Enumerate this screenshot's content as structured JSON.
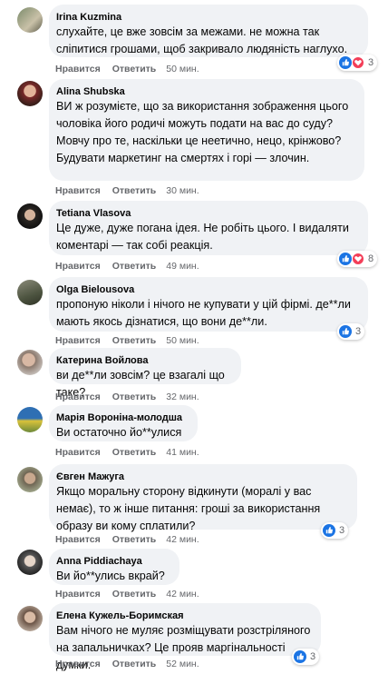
{
  "actions": {
    "like": "Нравится",
    "reply": "Ответить"
  },
  "comments": [
    {
      "author": "Irina Kuzmina",
      "text": "слухайте, це вже зовсім за межами. не можна так сліпитися грошами, щоб закривало людяність наглухо.",
      "time": "50 мин.",
      "reactions": "3",
      "icon": "avatar-photo"
    },
    {
      "author": "Alina Shubska",
      "text": "ВИ ж розумієте, що за використання зображення цього чоловіка його родичі можуть подати на вас до суду? Мовчу про те, наскільки це неетично, нецо, крінжово? Будувати маркетинг на смертях і горі — злочин.",
      "time": "30 мин.",
      "reactions": "",
      "icon": "avatar-photo"
    },
    {
      "author": "Tetiana Vlasova",
      "text": "Це дуже, дуже погана ідея. Не робіть цього. І видаляти коментарі — так собі реакція.",
      "time": "49 мин.",
      "reactions": "8",
      "icon": "avatar-photo"
    },
    {
      "author": "Olga Bielousova",
      "text": "пропоную ніколи і нічого не купувати у цій фірмі. де**ли мають якось дізнатися, що вони де**ли.",
      "time": "50 мин.",
      "reactions": "3",
      "icon": "avatar-photo"
    },
    {
      "author": "Катерина Войлова",
      "text": "ви де**ли зовсім? це взагалі що таке?",
      "time": "32 мин.",
      "reactions": "",
      "icon": "avatar-photo"
    },
    {
      "author": "Марія Вороніна-молодша",
      "text": "Ви остаточно йо**улися",
      "time": "41 мин.",
      "reactions": "",
      "icon": "avatar-photo"
    },
    {
      "author": "Євген Мажуга",
      "text": "Якщо моральну сторону відкинути (моралі у вас немає), то ж інше питання: гроші за використання образу ви кому сплатили?",
      "time": "42 мин.",
      "reactions": "3",
      "icon": "avatar-photo"
    },
    {
      "author": "Anna Piddiachaya",
      "text": "Ви йо**улись вкрай?",
      "time": "42 мин.",
      "reactions": "",
      "icon": "avatar-photo"
    },
    {
      "author": "Елена Кужель-Боримская",
      "text": "Вам нічого не муляє розміщувати розстріляного на запальничках? Це прояв маргінальності думки.",
      "time": "52 мин.",
      "reactions": "3",
      "icon": "avatar-photo"
    }
  ],
  "colors": {
    "like": "#1b74e4",
    "heart": "#f33e58",
    "bubble": "#f0f2f5",
    "meta": "#65676b"
  }
}
